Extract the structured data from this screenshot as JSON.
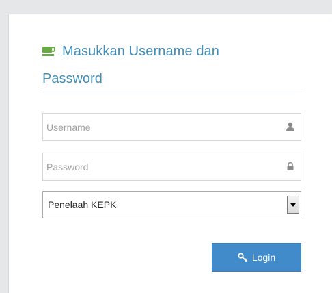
{
  "login_box": {
    "title_line1": "Masukkan Username dan",
    "title_line2": "Password",
    "title_icon": "coffee-icon",
    "accent_color": "#438eb9",
    "username_field": {
      "value": "",
      "placeholder": "Username",
      "icon": "user-icon"
    },
    "password_field": {
      "value": "",
      "placeholder": "Password",
      "icon": "lock-icon"
    },
    "role_select": {
      "selected": "Penelaah KEPK"
    },
    "login_button": {
      "label": "Login",
      "icon": "key-icon",
      "color": "#428bca"
    }
  }
}
